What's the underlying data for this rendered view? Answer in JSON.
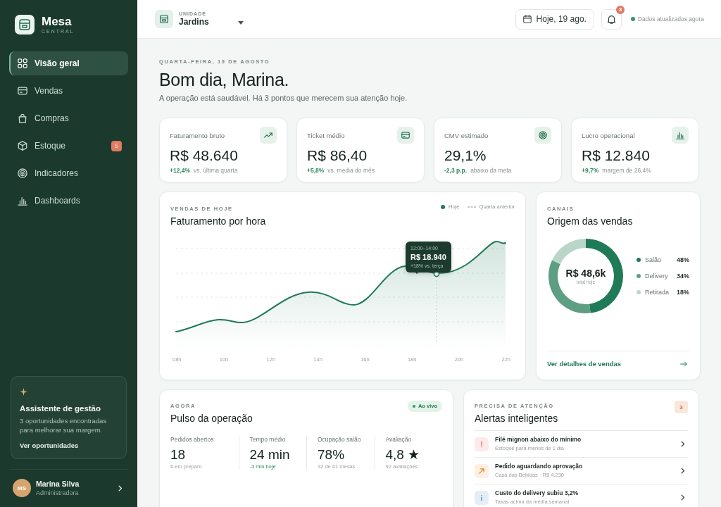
{
  "sidebar": {
    "logo": {
      "name": "Mesa",
      "tagline": "CENTRAL"
    },
    "items": [
      {
        "label": "Visão geral",
        "selected": true
      },
      {
        "label": "Vendas",
        "selected": false
      },
      {
        "label": "Compras",
        "selected": false
      },
      {
        "label": "Estoque",
        "selected": false,
        "badge": "5"
      },
      {
        "label": "Indicadores",
        "selected": false
      },
      {
        "label": "Dashboards",
        "selected": false
      }
    ],
    "assistant": {
      "title": "Assistente de gestão",
      "text": "3 oportunidades encontradas para melhorar sua margem.",
      "link": "Ver oportunidades"
    },
    "user": {
      "initials": "MS",
      "name": "Marina Silva",
      "role": "Administradora"
    }
  },
  "header": {
    "unit_label": "UNIDADE",
    "unit": "Jardins",
    "date": "Hoje, 19 ago.",
    "notifications": "3",
    "status": "Dados atualizados agora"
  },
  "greeting": {
    "date": "QUARTA-FEIRA, 19 DE AGOSTO",
    "title": "Bom dia, Marina.",
    "subtitle": "A operação está saudável. Há 3 pontos que merecem sua atenção hoje."
  },
  "kpis": [
    {
      "label": "Faturamento bruto",
      "value": "R$ 48.640",
      "delta": "+12,4%",
      "note": "vs. última quarta"
    },
    {
      "label": "Ticket médio",
      "value": "R$ 86,40",
      "delta": "+5,8%",
      "note": "vs. média do mês"
    },
    {
      "label": "CMV estimado",
      "value": "29,1%",
      "delta": "-2,3 p.p.",
      "note": "abaixo da meta"
    },
    {
      "label": "Lucro operacional",
      "value": "R$ 12.840",
      "delta": "+9,7%",
      "note": "margem de 26,4%"
    }
  ],
  "sales_chart": {
    "eyebrow": "VENDAS DE HOJE",
    "title": "Faturamento por hora",
    "legend": [
      {
        "label": "Hoje",
        "kind": "solid"
      },
      {
        "label": "Quarta anterior",
        "kind": "dashed"
      }
    ],
    "x_labels": [
      "08h",
      "10h",
      "12h",
      "14h",
      "16h",
      "18h",
      "20h",
      "22h"
    ],
    "tooltip": {
      "range": "12:00–14:00",
      "value": "R$ 18.940",
      "note": "+18% vs. terça"
    }
  },
  "channels": {
    "eyebrow": "CANAIS",
    "title": "Origem das vendas",
    "total": "R$ 48,6k",
    "total_label": "total hoje",
    "chart_data": {
      "type": "donut",
      "categories": [
        "Salão",
        "Delivery",
        "Retirada"
      ],
      "values": [
        48,
        34,
        18
      ],
      "colors": [
        "#1f7a57",
        "#5e9e82",
        "#b9d6c8"
      ],
      "value_labels": [
        "48%",
        "34%",
        "18%"
      ],
      "legend": "right"
    },
    "link": "Ver detalhes de vendas"
  },
  "pulse": {
    "eyebrow": "AGORA",
    "live": "Ao vivo",
    "title": "Pulso da operação",
    "stats": [
      {
        "label": "Pedidos abertos",
        "value": "18",
        "note": "6 em preparo",
        "positive": false
      },
      {
        "label": "Tempo médio",
        "value": "24 min",
        "note": "-3 min hoje",
        "positive": true
      },
      {
        "label": "Ocupação salão",
        "value": "78%",
        "note": "32 de 41 mesas",
        "positive": false
      },
      {
        "label": "Avaliação",
        "value": "4,8 ★",
        "note": "92 avaliações",
        "positive": false
      }
    ]
  },
  "alerts": {
    "eyebrow": "PRECISA DE ATENÇÃO",
    "count": "3",
    "title": "Alertas inteligentes",
    "items": [
      {
        "kind": "critical",
        "title": "Filé mignon abaixo do mínimo",
        "detail": "Estoque para menos de 1 dia"
      },
      {
        "kind": "approval",
        "title": "Pedido aguardando aprovação",
        "detail": "Casa das Bebidas · R$ 4.230"
      },
      {
        "kind": "info",
        "title": "Custo do delivery subiu 3,2%",
        "detail": "Taxas acima da média semanal"
      }
    ]
  }
}
